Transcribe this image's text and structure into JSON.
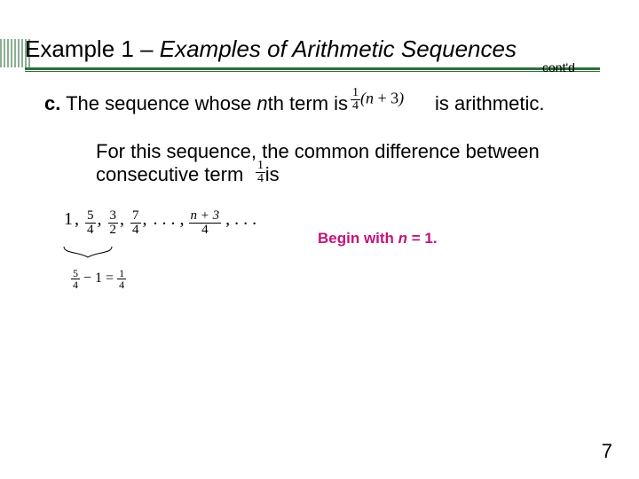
{
  "header": {
    "title_plain": "Example 1 – ",
    "title_ital": "Examples of Arithmetic Sequences",
    "contd": "cont'd"
  },
  "lines": {
    "c_label": "c.",
    "c_pre": " The sequence whose ",
    "c_nth_n": "n",
    "c_nth_rest": "th term is ",
    "c_post": " is arithmetic.",
    "p1": "For this sequence, the common difference between",
    "p2_a": "consecutive term",
    "p2_b": "is"
  },
  "formula": {
    "one": "1",
    "four": "4",
    "lpar": "(",
    "n": "n",
    "plus3": " + 3",
    "rpar": ")"
  },
  "smallfrac": {
    "num": "1",
    "den": "4",
    "tail": "."
  },
  "sequence": {
    "t1": "1",
    "t2": {
      "n": "5",
      "d": "4"
    },
    "t3": {
      "n": "3",
      "d": "2"
    },
    "t4": {
      "n": "7",
      "d": "4"
    },
    "dots1": ". . . ,",
    "gen": {
      "n": "n + 3",
      "d": "4"
    },
    "dots2": ", . . ."
  },
  "diff": {
    "a": {
      "n": "5",
      "d": "4"
    },
    "minus": " − ",
    "b": "1",
    "eq": " = ",
    "r": {
      "n": "1",
      "d": "4"
    }
  },
  "note": {
    "pre": "Begin with ",
    "n": "n",
    "post": " = 1."
  },
  "page": "7"
}
